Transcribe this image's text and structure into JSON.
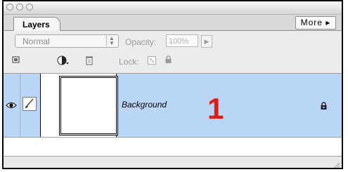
{
  "window": {
    "controls": [
      "close",
      "minimize",
      "zoom"
    ]
  },
  "panel": {
    "tab_label": "Layers",
    "more_button": "More ▸"
  },
  "options": {
    "blend_mode": "Normal",
    "opacity_label": "Opacity:",
    "opacity_value": "100%",
    "lock_label": "Lock:"
  },
  "layers": [
    {
      "name": "Background",
      "visible": true,
      "locked": true,
      "selected": true
    }
  ],
  "annotation": {
    "step_number": "1",
    "color": "#e01b12"
  },
  "colors": {
    "selection": "#b9d6f7",
    "panel": "#e8e8e8"
  }
}
